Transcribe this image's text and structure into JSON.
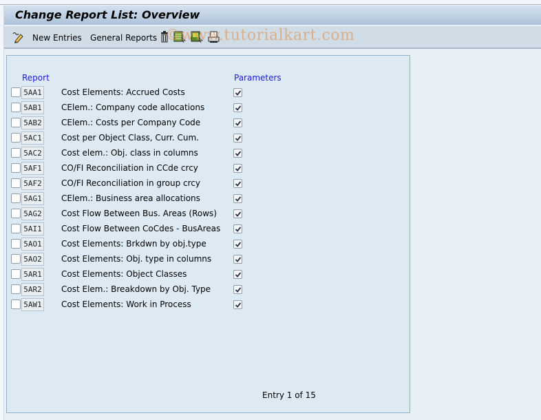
{
  "window": {
    "title": "Change Report List: Overview"
  },
  "toolbar": {
    "items": [
      {
        "icon": "display-change-icon",
        "label": ""
      },
      {
        "label": "New Entries"
      },
      {
        "label": "General Reports"
      },
      {
        "icon": "delete-icon"
      },
      {
        "icon": "select-all-icon"
      },
      {
        "icon": "select-block-icon"
      },
      {
        "icon": "print-icon"
      }
    ],
    "new_entries_label": "New Entries",
    "general_reports_label": "General Reports"
  },
  "watermark": "©www.tutorialkart.com",
  "table": {
    "headers": {
      "report": "Report",
      "parameters": "Parameters"
    },
    "rows": [
      {
        "selected": false,
        "code": "5AA1",
        "description": "Cost Elements: Accrued Costs",
        "parameters": true
      },
      {
        "selected": false,
        "code": "5AB1",
        "description": "CElem.: Company code allocations",
        "parameters": true
      },
      {
        "selected": false,
        "code": "5AB2",
        "description": "CElem.: Costs per Company Code",
        "parameters": true
      },
      {
        "selected": false,
        "code": "5AC1",
        "description": "Cost per Object Class, Curr. Cum.",
        "parameters": true
      },
      {
        "selected": false,
        "code": "5AC2",
        "description": "Cost elem.: Obj. class in columns",
        "parameters": true
      },
      {
        "selected": false,
        "code": "5AF1",
        "description": "CO/FI Reconciliation in CCde crcy",
        "parameters": true
      },
      {
        "selected": false,
        "code": "5AF2",
        "description": "CO/FI Reconciliation in group crcy",
        "parameters": true
      },
      {
        "selected": false,
        "code": "5AG1",
        "description": "CElem.: Business area allocations",
        "parameters": true
      },
      {
        "selected": false,
        "code": "5AG2",
        "description": "Cost Flow Between Bus. Areas (Rows)",
        "parameters": true
      },
      {
        "selected": false,
        "code": "5AI1",
        "description": "Cost Flow Between CoCdes - BusAreas",
        "parameters": true
      },
      {
        "selected": false,
        "code": "5AO1",
        "description": "Cost Elements: Brkdwn by obj.type",
        "parameters": true
      },
      {
        "selected": false,
        "code": "5AO2",
        "description": "Cost Elements: Obj. type in columns",
        "parameters": true
      },
      {
        "selected": false,
        "code": "5AR1",
        "description": "Cost Elements: Object Classes",
        "parameters": true
      },
      {
        "selected": false,
        "code": "5AR2",
        "description": "Cost Elem.: Breakdown by Obj. Type",
        "parameters": true
      },
      {
        "selected": false,
        "code": "5AW1",
        "description": "Cost Elements: Work in Process",
        "parameters": true
      }
    ]
  },
  "footer": {
    "entry_text": "Entry 1 of 15"
  }
}
